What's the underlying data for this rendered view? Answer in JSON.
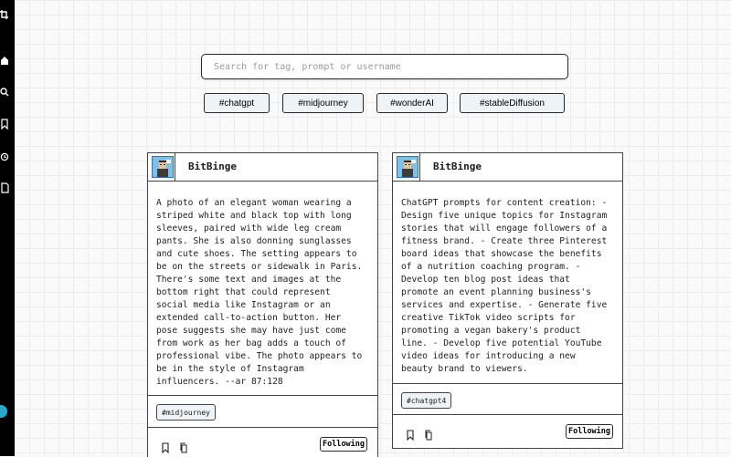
{
  "sidebar": {
    "icons": [
      "brand-icon",
      "home-icon",
      "search-icon",
      "bookmark-icon",
      "history-icon",
      "document-icon"
    ]
  },
  "search": {
    "placeholder": "Search for tag, prompt or username"
  },
  "filter_tags": [
    "#chatgpt",
    "#midjourney",
    "#wonderAI",
    "#stableDiffusion"
  ],
  "cards": [
    {
      "username": "BitBinge",
      "prompt": "A photo of an elegant woman wearing a striped white and black top with long sleeves, paired with wide leg cream pants. She is also donning sunglasses and cute shoes. The setting appears to be on the streets or sidewalk in Paris. There's some text and images at the bottom right that could represent social media like Instagram or an extended call-to-action button. Her pose suggests she may have just come from work as her bag adds a touch of professional vibe. The photo appears to be in the style of Instagram influencers. --ar 87:128",
      "tag": "#midjourney",
      "follow_label": "Following"
    },
    {
      "username": "BitBinge",
      "prompt": "ChatGPT prompts for content creation: - Design five unique topics for Instagram stories that will engage followers of a fitness brand. - Create three Pinterest board ideas that showcase the benefits of a nutrition coaching program. - Develop ten blog post ideas that promote an event planning business's services and expertise. - Generate five creative TikTok video scripts for promoting a vegan bakery's product line. - Develop five potential YouTube video ideas for introducing a new beauty brand to viewers.",
      "tag": "#chatgpt4",
      "follow_label": "Following"
    }
  ]
}
